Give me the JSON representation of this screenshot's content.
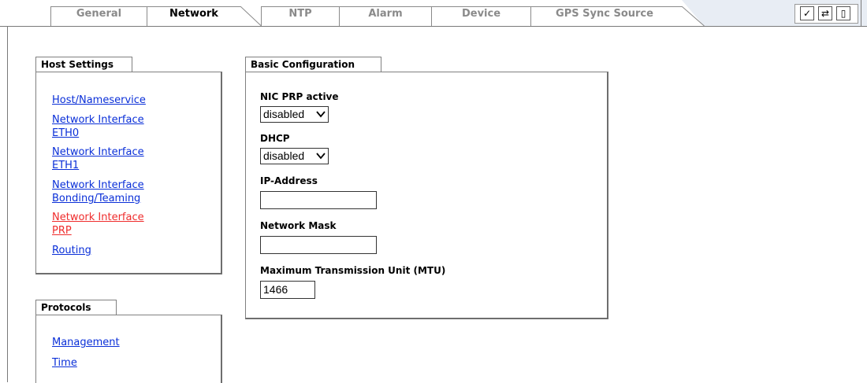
{
  "tabs": [
    {
      "label": "General",
      "active": false
    },
    {
      "label": "Network",
      "active": true
    },
    {
      "label": "NTP",
      "active": false
    },
    {
      "label": "Alarm",
      "active": false
    },
    {
      "label": "Device",
      "active": false
    },
    {
      "label": "GPS Sync Source",
      "active": false
    }
  ],
  "toolbar": {
    "apply_glyph": "✓",
    "reload_glyph": "⇄",
    "save_glyph": "▯",
    "icons": [
      "checkmark-icon",
      "reload-icon",
      "save-icon"
    ]
  },
  "host_settings": {
    "title": "Host Settings",
    "links": [
      {
        "line1": "Host/Nameservice",
        "line2": ""
      },
      {
        "line1": "Network Interface",
        "line2": "ETH0"
      },
      {
        "line1": "Network Interface",
        "line2": "ETH1"
      },
      {
        "line1": "Network Interface",
        "line2": "Bonding/Teaming"
      },
      {
        "line1": "Network Interface",
        "line2": "PRP"
      },
      {
        "line1": "Routing",
        "line2": ""
      }
    ],
    "current_index": 4
  },
  "protocols": {
    "title": "Protocols",
    "links": [
      "Management",
      "Time"
    ]
  },
  "basic_config": {
    "title": "Basic Configuration",
    "nic_prp": {
      "label": "NIC PRP active",
      "value": "disabled"
    },
    "dhcp": {
      "label": "DHCP",
      "value": "disabled"
    },
    "ip_address": {
      "label": "IP-Address",
      "value": ""
    },
    "network_mask": {
      "label": "Network Mask",
      "value": ""
    },
    "mtu": {
      "label": "Maximum Transmission Unit (MTU)",
      "value": "1466"
    }
  },
  "colors": {
    "link": "#0a2fd8",
    "link_current": "#ef2c2c",
    "tab_inactive_text": "#8a8a8a",
    "tab_bar_fill": "#e8edf4"
  }
}
